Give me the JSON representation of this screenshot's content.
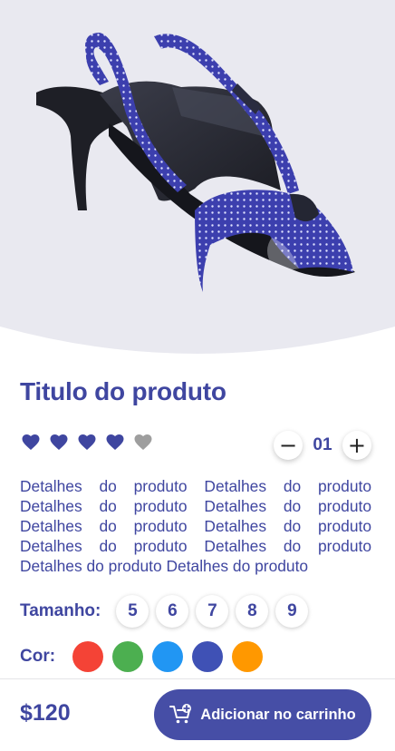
{
  "product": {
    "title": "Titulo do produto",
    "image_icon": "high-heel-sandal-image",
    "rating": {
      "value": 4,
      "max": 5,
      "filled_color": "#3f46a0",
      "empty_color": "#9e9e9e"
    },
    "quantity": {
      "value": "01",
      "minus": "−",
      "plus": "+"
    },
    "description": "Detalhes do produto Detalhes do produto Detalhes do produto Detalhes do produto Detalhes do produto Detalhes do produto Detalhes do produto Detalhes do produto Detalhes do produto Detalhes do produto",
    "sizes_label": "Tamanho:",
    "sizes": [
      "5",
      "6",
      "7",
      "8",
      "9"
    ],
    "colors_label": "Cor:",
    "colors": [
      "#f44336",
      "#4caf50",
      "#2196f3",
      "#3f51b5",
      "#ff9800"
    ]
  },
  "footer": {
    "price": "$120",
    "cart_button_label": "Adicionar no carrinho",
    "cart_icon": "add-to-cart-icon"
  },
  "theme": {
    "accent": "#3f46a0",
    "hero_background": "#e9e9f0"
  }
}
